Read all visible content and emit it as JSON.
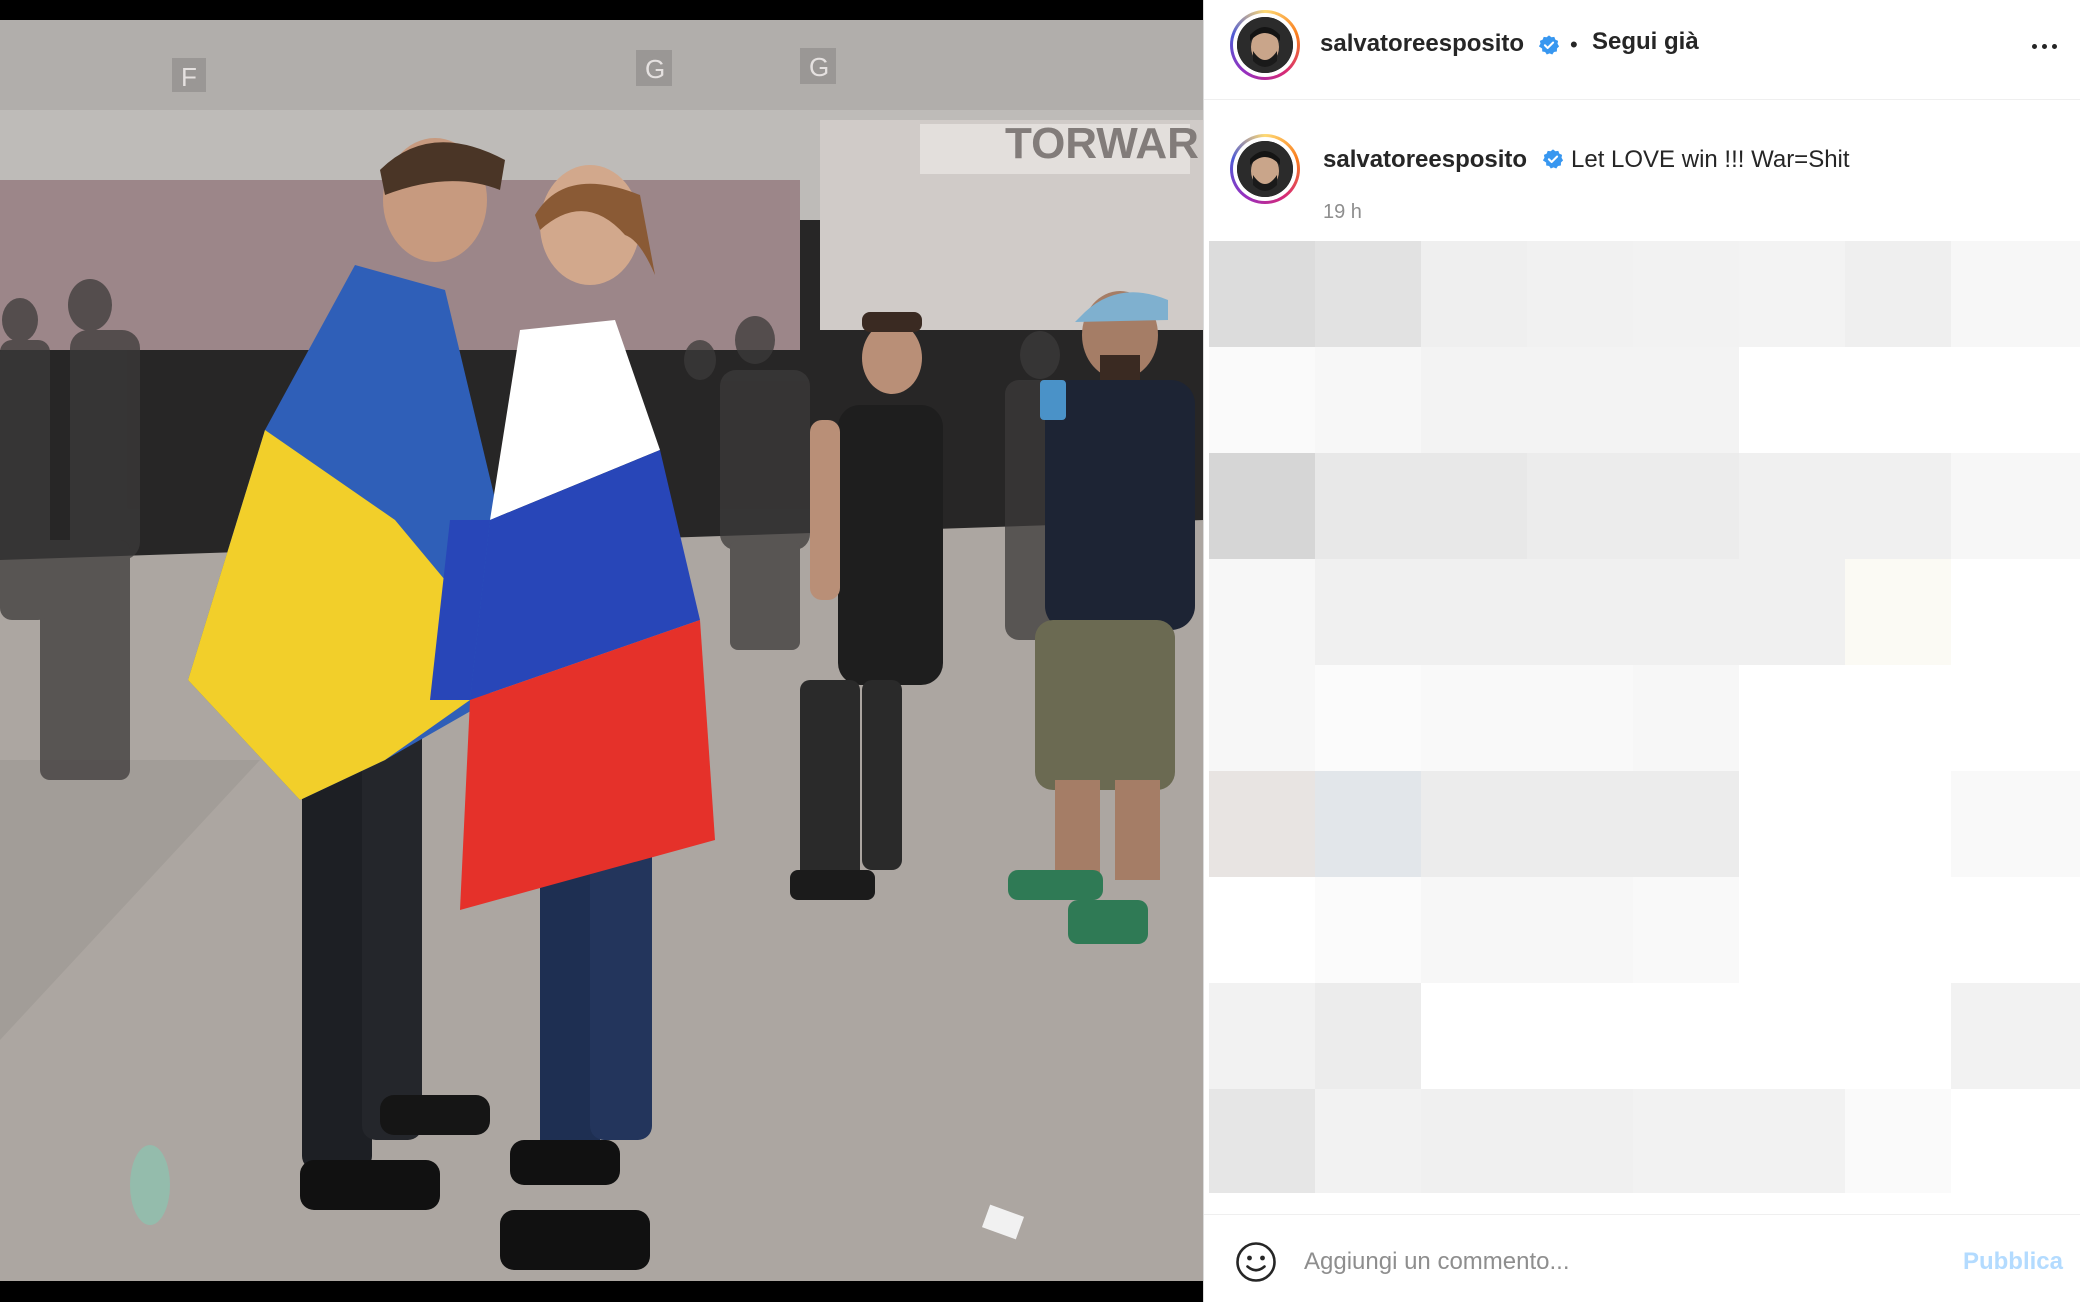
{
  "post": {
    "username": "salvatoreesposito",
    "follow_state": "Segui già",
    "separator": "•",
    "caption": "Let LOVE win !!! War=Shit",
    "timestamp": "19 h"
  },
  "photo": {
    "signs": [
      "F",
      "G",
      "G"
    ],
    "banner_text": "TORWAR",
    "flag_left_colors": [
      "#2f5fb8",
      "#f2cf2a"
    ],
    "flag_right_colors": [
      "#ffffff",
      "#2846b8",
      "#e5312a"
    ]
  },
  "comment_bar": {
    "placeholder": "Aggiungi un commento...",
    "publish_label": "Pubblica"
  },
  "colors": {
    "verified": "#3897f0",
    "publish_disabled": "#b3dbff",
    "secondary_text": "#8e8e8e"
  },
  "icons": {
    "more": "more-options-icon",
    "verified": "verified-badge-icon",
    "emoji": "emoji-icon"
  }
}
